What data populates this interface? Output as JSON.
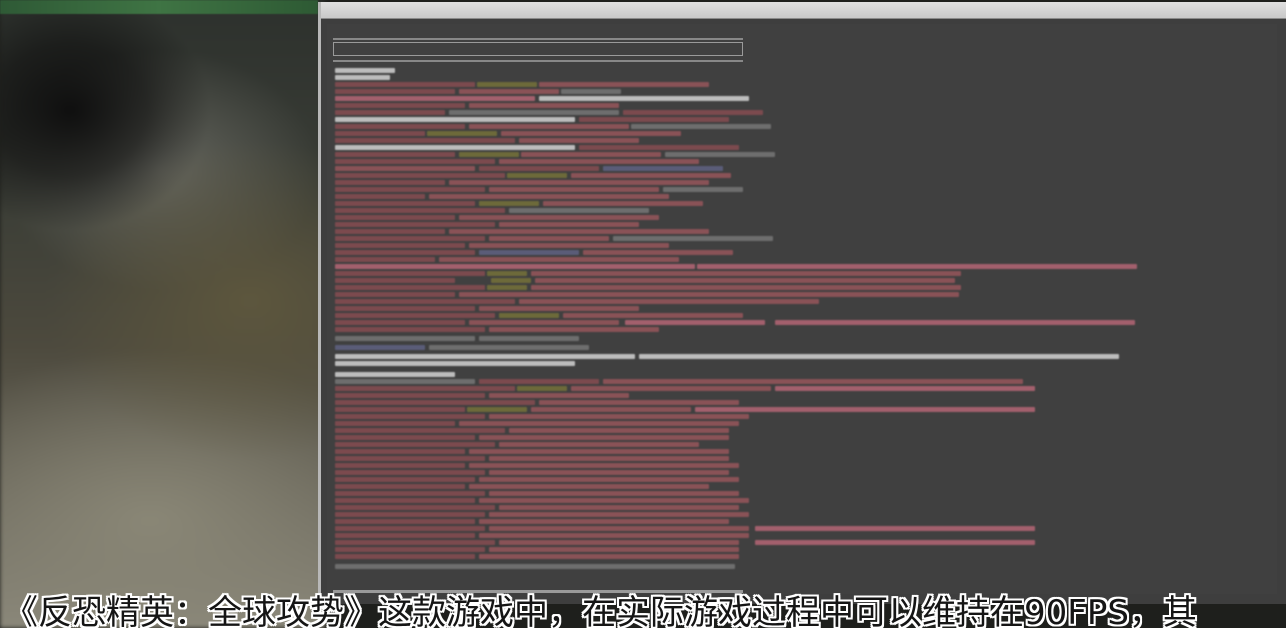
{
  "game": {
    "topbar_text": ""
  },
  "console": {
    "title": "",
    "command": "",
    "lines": []
  },
  "subtitle": {
    "text": "《反恐精英：全球攻势》这款游戏中，在实际游戏过程中可以维持在90FPS，其"
  },
  "colors": {
    "console_bg": "#404040",
    "window_frame": "#b8b8b8",
    "log_red": "#7c4a4e",
    "log_pink": "#a3606d",
    "log_olive": "#6d6a3a",
    "subtitle_text": "#151515",
    "subtitle_outline": "#ffffff"
  }
}
